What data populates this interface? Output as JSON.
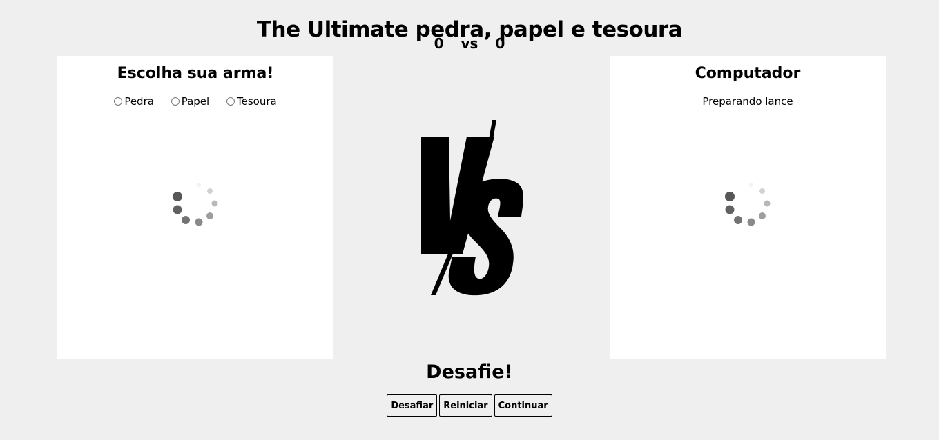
{
  "header": {
    "title": "The Ultimate pedra, papel e tesoura",
    "score": {
      "player": "0",
      "separator": "vs",
      "computer": "0"
    }
  },
  "player_panel": {
    "heading": "Escolha sua arma!",
    "options": [
      {
        "label": "Pedra",
        "value": "pedra",
        "selected": false
      },
      {
        "label": "Papel",
        "value": "papel",
        "selected": false
      },
      {
        "label": "Tesoura",
        "value": "tesoura",
        "selected": false
      }
    ],
    "loading_icon": "spinner-icon"
  },
  "vs_graphic": {
    "icon": "vs-icon",
    "color": "#000000"
  },
  "computer_panel": {
    "heading": "Computador",
    "status": "Preparando lance",
    "loading_icon": "spinner-icon"
  },
  "footer": {
    "challenge_text": "Desafie!",
    "buttons": {
      "challenge": "Desafiar",
      "restart": "Reiniciar",
      "continue": "Continuar"
    }
  },
  "colors": {
    "page_background": "#efefef",
    "panel_background": "#ffffff",
    "text": "#000000"
  }
}
